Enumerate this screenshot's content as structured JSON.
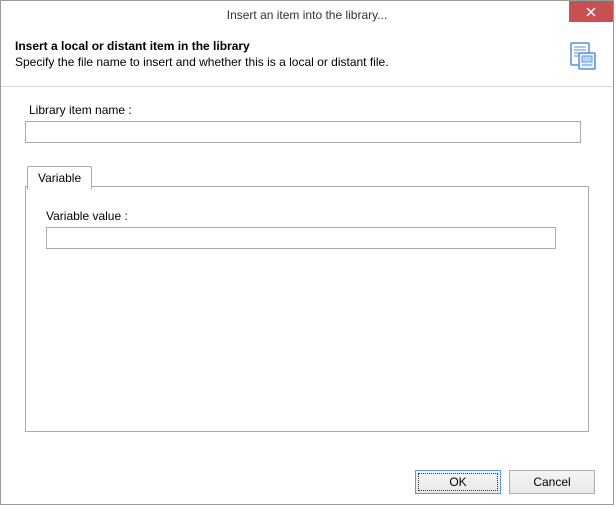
{
  "titlebar": {
    "title": "Insert an item into the library..."
  },
  "header": {
    "title": "Insert a local or distant item in the library",
    "subtitle": "Specify the file name to insert and whether this is a local or distant file."
  },
  "form": {
    "library_item_label": "Library item name :",
    "library_item_value": ""
  },
  "tabs": {
    "variable_label": "Variable",
    "variable_value_label": "Variable value :",
    "variable_value": ""
  },
  "buttons": {
    "ok": "OK",
    "cancel": "Cancel"
  }
}
